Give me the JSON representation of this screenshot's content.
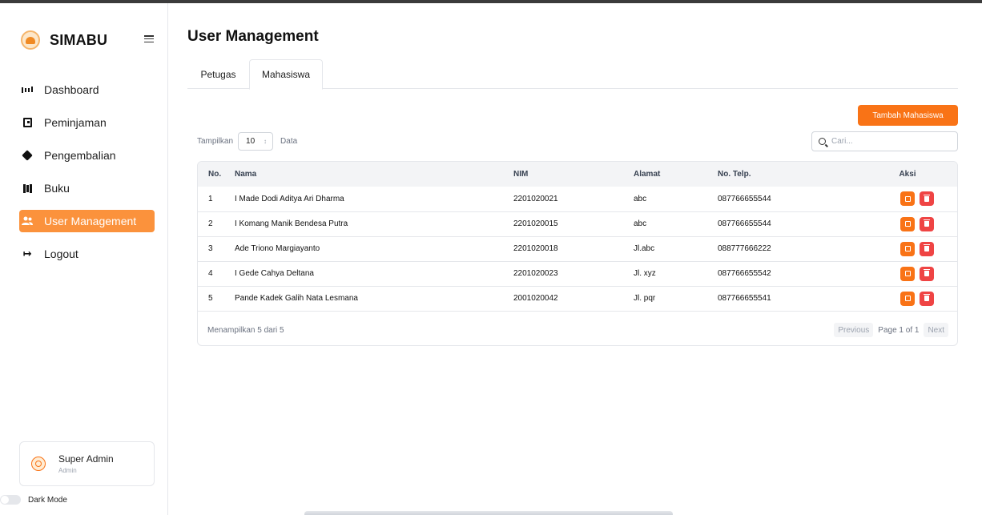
{
  "app": {
    "name": "SIMABU"
  },
  "sidebar": {
    "items": [
      {
        "label": "Dashboard",
        "icon": "dashboard-icon"
      },
      {
        "label": "Peminjaman",
        "icon": "book-icon"
      },
      {
        "label": "Pengembalian",
        "icon": "box-icon"
      },
      {
        "label": "Buku",
        "icon": "books-icon"
      },
      {
        "label": "User Management",
        "icon": "users-icon",
        "active": true
      },
      {
        "label": "Logout",
        "icon": "logout-icon"
      }
    ],
    "profile": {
      "name": "Super Admin",
      "role": "Admin"
    },
    "dark_mode_label": "Dark Mode",
    "dark_mode_on": false
  },
  "page": {
    "title": "User Management"
  },
  "tabs": [
    {
      "label": "Petugas",
      "active": false
    },
    {
      "label": "Mahasiswa",
      "active": true
    }
  ],
  "toolbar": {
    "add_label": "Tambah Mahasiswa",
    "show_label": "Tampilkan",
    "show_value": "10",
    "show_suffix": "Data",
    "search_placeholder": "Cari..."
  },
  "table": {
    "columns": [
      "No.",
      "Nama",
      "NIM",
      "Alamat",
      "No. Telp.",
      "Aksi"
    ],
    "rows": [
      {
        "no": "1",
        "nama": "I Made Dodi Aditya Ari Dharma",
        "nim": "2201020021",
        "alamat": "abc",
        "telp": "087766655544"
      },
      {
        "no": "2",
        "nama": "I Komang Manik Bendesa Putra",
        "nim": "2201020015",
        "alamat": "abc",
        "telp": "087766655544"
      },
      {
        "no": "3",
        "nama": "Ade Triono Margiayanto",
        "nim": "2201020018",
        "alamat": "Jl.abc",
        "telp": "088777666222"
      },
      {
        "no": "4",
        "nama": "I Gede Cahya Deltana",
        "nim": "2201020023",
        "alamat": "Jl. xyz",
        "telp": "087766655542"
      },
      {
        "no": "5",
        "nama": "Pande Kadek Galih Nata Lesmana",
        "nim": "2001020042",
        "alamat": "Jl. pqr",
        "telp": "087766655541"
      }
    ],
    "footer_info": "Menampilkan 5 dari 5",
    "prev_label": "Previous",
    "page_info": "Page 1 of 1",
    "next_label": "Next"
  },
  "colors": {
    "accent": "#f97316",
    "danger": "#ef4444",
    "active_nav": "#fb923c"
  }
}
